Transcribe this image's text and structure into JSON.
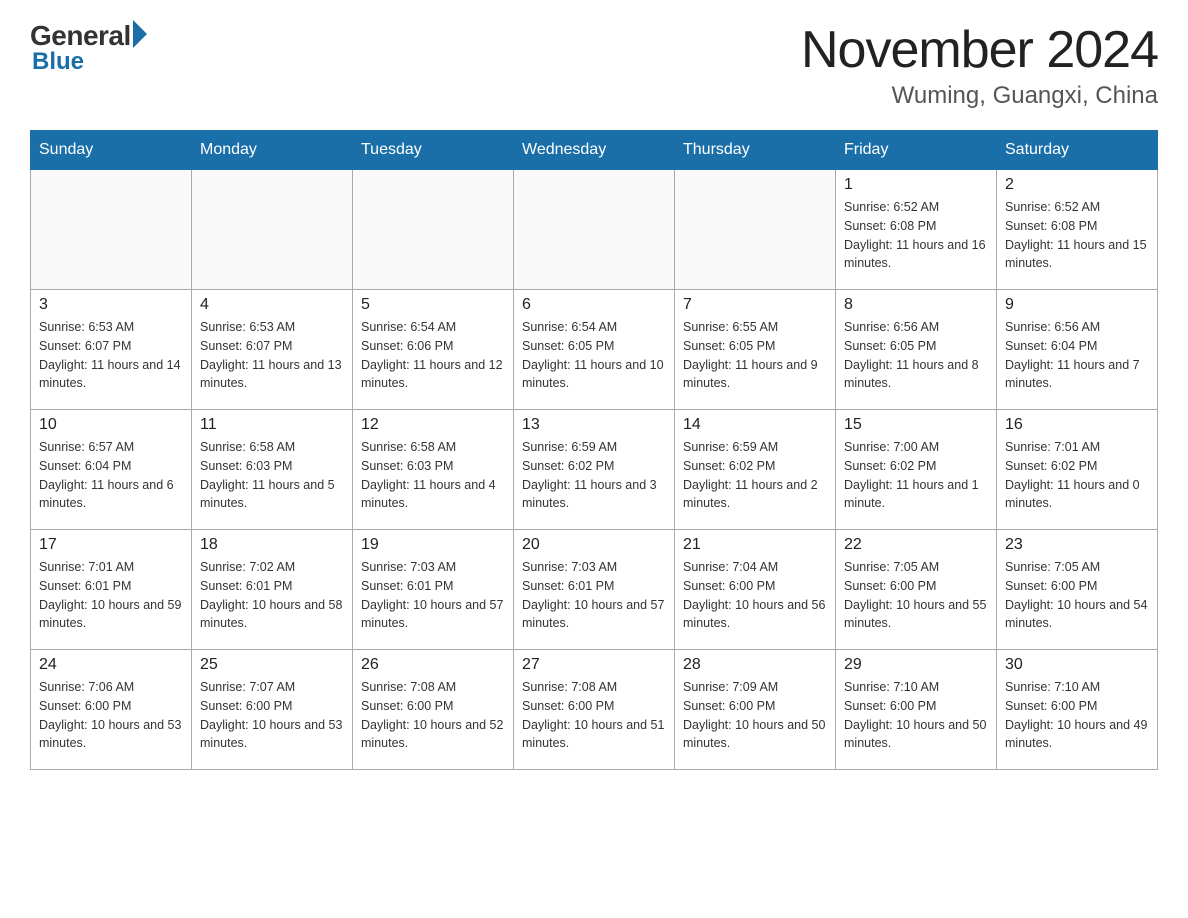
{
  "logo": {
    "general": "General",
    "blue": "Blue"
  },
  "title": {
    "month": "November 2024",
    "location": "Wuming, Guangxi, China"
  },
  "weekdays": [
    "Sunday",
    "Monday",
    "Tuesday",
    "Wednesday",
    "Thursday",
    "Friday",
    "Saturday"
  ],
  "weeks": [
    [
      {
        "day": "",
        "info": ""
      },
      {
        "day": "",
        "info": ""
      },
      {
        "day": "",
        "info": ""
      },
      {
        "day": "",
        "info": ""
      },
      {
        "day": "",
        "info": ""
      },
      {
        "day": "1",
        "info": "Sunrise: 6:52 AM\nSunset: 6:08 PM\nDaylight: 11 hours and 16 minutes."
      },
      {
        "day": "2",
        "info": "Sunrise: 6:52 AM\nSunset: 6:08 PM\nDaylight: 11 hours and 15 minutes."
      }
    ],
    [
      {
        "day": "3",
        "info": "Sunrise: 6:53 AM\nSunset: 6:07 PM\nDaylight: 11 hours and 14 minutes."
      },
      {
        "day": "4",
        "info": "Sunrise: 6:53 AM\nSunset: 6:07 PM\nDaylight: 11 hours and 13 minutes."
      },
      {
        "day": "5",
        "info": "Sunrise: 6:54 AM\nSunset: 6:06 PM\nDaylight: 11 hours and 12 minutes."
      },
      {
        "day": "6",
        "info": "Sunrise: 6:54 AM\nSunset: 6:05 PM\nDaylight: 11 hours and 10 minutes."
      },
      {
        "day": "7",
        "info": "Sunrise: 6:55 AM\nSunset: 6:05 PM\nDaylight: 11 hours and 9 minutes."
      },
      {
        "day": "8",
        "info": "Sunrise: 6:56 AM\nSunset: 6:05 PM\nDaylight: 11 hours and 8 minutes."
      },
      {
        "day": "9",
        "info": "Sunrise: 6:56 AM\nSunset: 6:04 PM\nDaylight: 11 hours and 7 minutes."
      }
    ],
    [
      {
        "day": "10",
        "info": "Sunrise: 6:57 AM\nSunset: 6:04 PM\nDaylight: 11 hours and 6 minutes."
      },
      {
        "day": "11",
        "info": "Sunrise: 6:58 AM\nSunset: 6:03 PM\nDaylight: 11 hours and 5 minutes."
      },
      {
        "day": "12",
        "info": "Sunrise: 6:58 AM\nSunset: 6:03 PM\nDaylight: 11 hours and 4 minutes."
      },
      {
        "day": "13",
        "info": "Sunrise: 6:59 AM\nSunset: 6:02 PM\nDaylight: 11 hours and 3 minutes."
      },
      {
        "day": "14",
        "info": "Sunrise: 6:59 AM\nSunset: 6:02 PM\nDaylight: 11 hours and 2 minutes."
      },
      {
        "day": "15",
        "info": "Sunrise: 7:00 AM\nSunset: 6:02 PM\nDaylight: 11 hours and 1 minute."
      },
      {
        "day": "16",
        "info": "Sunrise: 7:01 AM\nSunset: 6:02 PM\nDaylight: 11 hours and 0 minutes."
      }
    ],
    [
      {
        "day": "17",
        "info": "Sunrise: 7:01 AM\nSunset: 6:01 PM\nDaylight: 10 hours and 59 minutes."
      },
      {
        "day": "18",
        "info": "Sunrise: 7:02 AM\nSunset: 6:01 PM\nDaylight: 10 hours and 58 minutes."
      },
      {
        "day": "19",
        "info": "Sunrise: 7:03 AM\nSunset: 6:01 PM\nDaylight: 10 hours and 57 minutes."
      },
      {
        "day": "20",
        "info": "Sunrise: 7:03 AM\nSunset: 6:01 PM\nDaylight: 10 hours and 57 minutes."
      },
      {
        "day": "21",
        "info": "Sunrise: 7:04 AM\nSunset: 6:00 PM\nDaylight: 10 hours and 56 minutes."
      },
      {
        "day": "22",
        "info": "Sunrise: 7:05 AM\nSunset: 6:00 PM\nDaylight: 10 hours and 55 minutes."
      },
      {
        "day": "23",
        "info": "Sunrise: 7:05 AM\nSunset: 6:00 PM\nDaylight: 10 hours and 54 minutes."
      }
    ],
    [
      {
        "day": "24",
        "info": "Sunrise: 7:06 AM\nSunset: 6:00 PM\nDaylight: 10 hours and 53 minutes."
      },
      {
        "day": "25",
        "info": "Sunrise: 7:07 AM\nSunset: 6:00 PM\nDaylight: 10 hours and 53 minutes."
      },
      {
        "day": "26",
        "info": "Sunrise: 7:08 AM\nSunset: 6:00 PM\nDaylight: 10 hours and 52 minutes."
      },
      {
        "day": "27",
        "info": "Sunrise: 7:08 AM\nSunset: 6:00 PM\nDaylight: 10 hours and 51 minutes."
      },
      {
        "day": "28",
        "info": "Sunrise: 7:09 AM\nSunset: 6:00 PM\nDaylight: 10 hours and 50 minutes."
      },
      {
        "day": "29",
        "info": "Sunrise: 7:10 AM\nSunset: 6:00 PM\nDaylight: 10 hours and 50 minutes."
      },
      {
        "day": "30",
        "info": "Sunrise: 7:10 AM\nSunset: 6:00 PM\nDaylight: 10 hours and 49 minutes."
      }
    ]
  ]
}
